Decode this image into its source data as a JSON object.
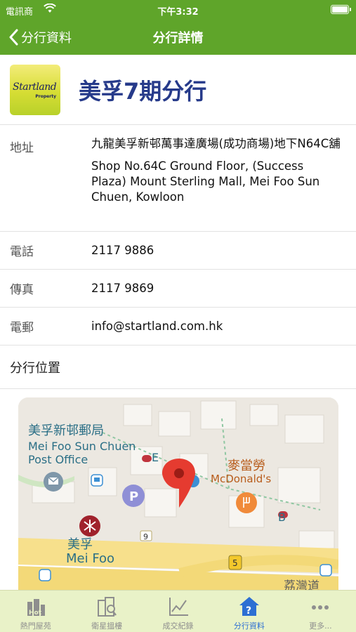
{
  "status_bar": {
    "carrier": "電訊商",
    "time": "下午3:32"
  },
  "nav": {
    "back_label": "分行資料",
    "title": "分行詳情"
  },
  "branch": {
    "logo_text": "Startland",
    "logo_subtext": "Property",
    "name": "美孚7期分行"
  },
  "details": {
    "address_label": "地址",
    "address_zh": "九龍美孚新邨萬事達廣場(成功商場)地下N64C舖",
    "address_en": "Shop No.64C Ground Floor, (Success Plaza) Mount Sterling Mall, Mei Foo Sun Chuen, Kowloon",
    "phone_label": "電話",
    "phone": "2117 9886",
    "fax_label": "傳真",
    "fax": "2117 9869",
    "email_label": "電郵",
    "email": "info@startland.com.hk"
  },
  "location": {
    "section_title": "分行位置",
    "map_labels": {
      "post_office_zh": "美孚新邨郵局",
      "post_office_en": "Mei Foo Sun Chuen Post Office",
      "mcdonalds_zh": "麥當勞",
      "mcdonalds_en": "McDonald's",
      "mtr_zh": "美孚",
      "mtr_en": "Mei Foo",
      "exit_e": "E",
      "exit_b": "B",
      "route_9": "9",
      "route_5": "5",
      "road_partial": "荔灣道"
    }
  },
  "tabs": [
    {
      "label": "熱門屋苑",
      "icon": "hot-buildings-icon",
      "active": false
    },
    {
      "label": "衛星搵樓",
      "icon": "satellite-search-icon",
      "active": false
    },
    {
      "label": "成交紀錄",
      "icon": "chart-line-icon",
      "active": false
    },
    {
      "label": "分行資料",
      "icon": "branch-house-icon",
      "active": true
    },
    {
      "label": "更多...",
      "icon": "more-dots-icon",
      "active": false
    }
  ],
  "colors": {
    "header_green": "#5fa52a",
    "tab_bar_bg": "#e9f2c8",
    "active_blue": "#2d6fd3",
    "branch_name": "#263a8a"
  }
}
